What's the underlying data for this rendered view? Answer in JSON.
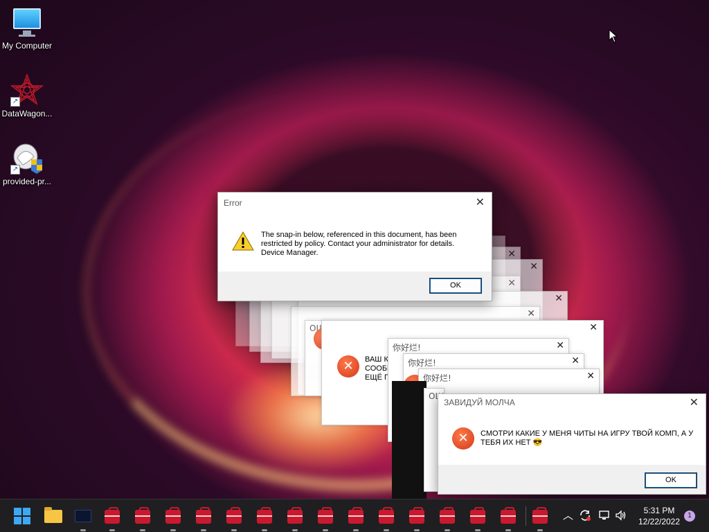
{
  "desktop": {
    "icons": [
      {
        "label": "My Computer"
      },
      {
        "label": "DataWagon..."
      },
      {
        "label": "provided-pr..."
      }
    ]
  },
  "ghost_titles": {
    "russian_error": "ОШИБКА",
    "chinese_1": "你好烂!",
    "chinese_2": "你好烂!",
    "chinese_3": "你好烂!",
    "partial": "ОШ"
  },
  "ghost_body": {
    "line1": "ВАШ К",
    "line2": "СООБЩ",
    "line3": "ЕЩЁ П"
  },
  "error_dialog": {
    "title": "Error",
    "message_line1": "The snap-in below, referenced in this document, has been",
    "message_line2": "restricted by policy. Contact your administrator for details.",
    "message_line3": "Device Manager.",
    "ok_label": "OK",
    "close_glyph": "✕"
  },
  "cheat_dialog": {
    "title": "ЗАВИДУЙ МОЛЧА",
    "message_line1": "СМОТРИ КАКИЕ У МЕНЯ ЧИТЫ НА ИГРУ ТВОЙ КОМП, А У",
    "message_line2": "ТЕБЯ ИХ НЕТ 😎",
    "ok_label": "OK",
    "close_glyph": "✕"
  },
  "taskbar": {
    "clock_time": "5:31 PM",
    "clock_date": "12/22/2022",
    "notification_count": "1",
    "toolbox_app_count": 14
  },
  "colors": {
    "accent": "#0067c0",
    "error_red": "#d2381b",
    "taskbar_bg": "#1f1f22"
  }
}
